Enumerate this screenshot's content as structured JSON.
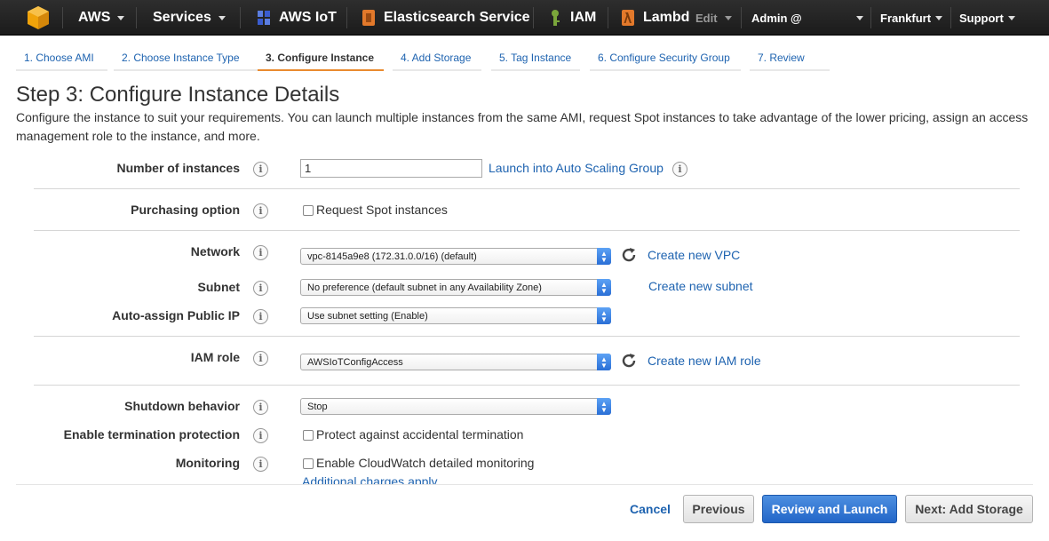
{
  "topnav": {
    "aws_label": "AWS",
    "services_label": "Services",
    "shortcuts": [
      {
        "label": "AWS IoT",
        "icon": "aws-iot-icon",
        "color": "#3a5ccf"
      },
      {
        "label": "Elasticsearch Service",
        "icon": "elasticsearch-icon",
        "color": "#e2792b"
      },
      {
        "label": "IAM",
        "icon": "iam-icon",
        "color": "#7aa63b"
      },
      {
        "label": "Lambd",
        "icon": "lambda-icon",
        "color": "#e2792b"
      }
    ],
    "edit_label": "Edit",
    "account_label": "Admin @",
    "region_label": "Frankfurt",
    "support_label": "Support"
  },
  "wizard_tabs": [
    {
      "label": "1. Choose AMI",
      "active": false
    },
    {
      "label": "2. Choose Instance Type",
      "active": false
    },
    {
      "label": "3. Configure Instance",
      "active": true
    },
    {
      "label": "4. Add Storage",
      "active": false
    },
    {
      "label": "5. Tag Instance",
      "active": false
    },
    {
      "label": "6. Configure Security Group",
      "active": false
    },
    {
      "label": "7. Review",
      "active": false
    }
  ],
  "page": {
    "title": "Step 3: Configure Instance Details",
    "description": "Configure the instance to suit your requirements. You can launch multiple instances from the same AMI, request Spot instances to take advantage of the lower pricing, assign an access management role to the instance, and more."
  },
  "form": {
    "number_of_instances": {
      "label": "Number of instances",
      "value": "1",
      "link": "Launch into Auto Scaling Group"
    },
    "purchasing_option": {
      "label": "Purchasing option",
      "checkbox_label": "Request Spot instances"
    },
    "network": {
      "label": "Network",
      "value": "vpc-8145a9e8 (172.31.0.0/16) (default)",
      "link": "Create new VPC"
    },
    "subnet": {
      "label": "Subnet",
      "value": "No preference (default subnet in any Availability Zone)",
      "link": "Create new subnet"
    },
    "auto_assign_ip": {
      "label": "Auto-assign Public IP",
      "value": "Use subnet setting (Enable)"
    },
    "iam_role": {
      "label": "IAM role",
      "value": "AWSIoTConfigAccess",
      "link": "Create new IAM role"
    },
    "shutdown_behavior": {
      "label": "Shutdown behavior",
      "value": "Stop"
    },
    "termination_protection": {
      "label": "Enable termination protection",
      "checkbox_label": "Protect against accidental termination"
    },
    "monitoring": {
      "label": "Monitoring",
      "checkbox_label": "Enable CloudWatch detailed monitoring",
      "link": "Additional charges apply"
    }
  },
  "footer": {
    "cancel_label": "Cancel",
    "previous_label": "Previous",
    "review_launch_label": "Review and Launch",
    "next_label": "Next: Add Storage"
  },
  "colors": {
    "link": "#1e63b0",
    "active_tab_underline": "#e98b2f",
    "primary_button": "#2266c8",
    "nav_background": "#232323"
  }
}
